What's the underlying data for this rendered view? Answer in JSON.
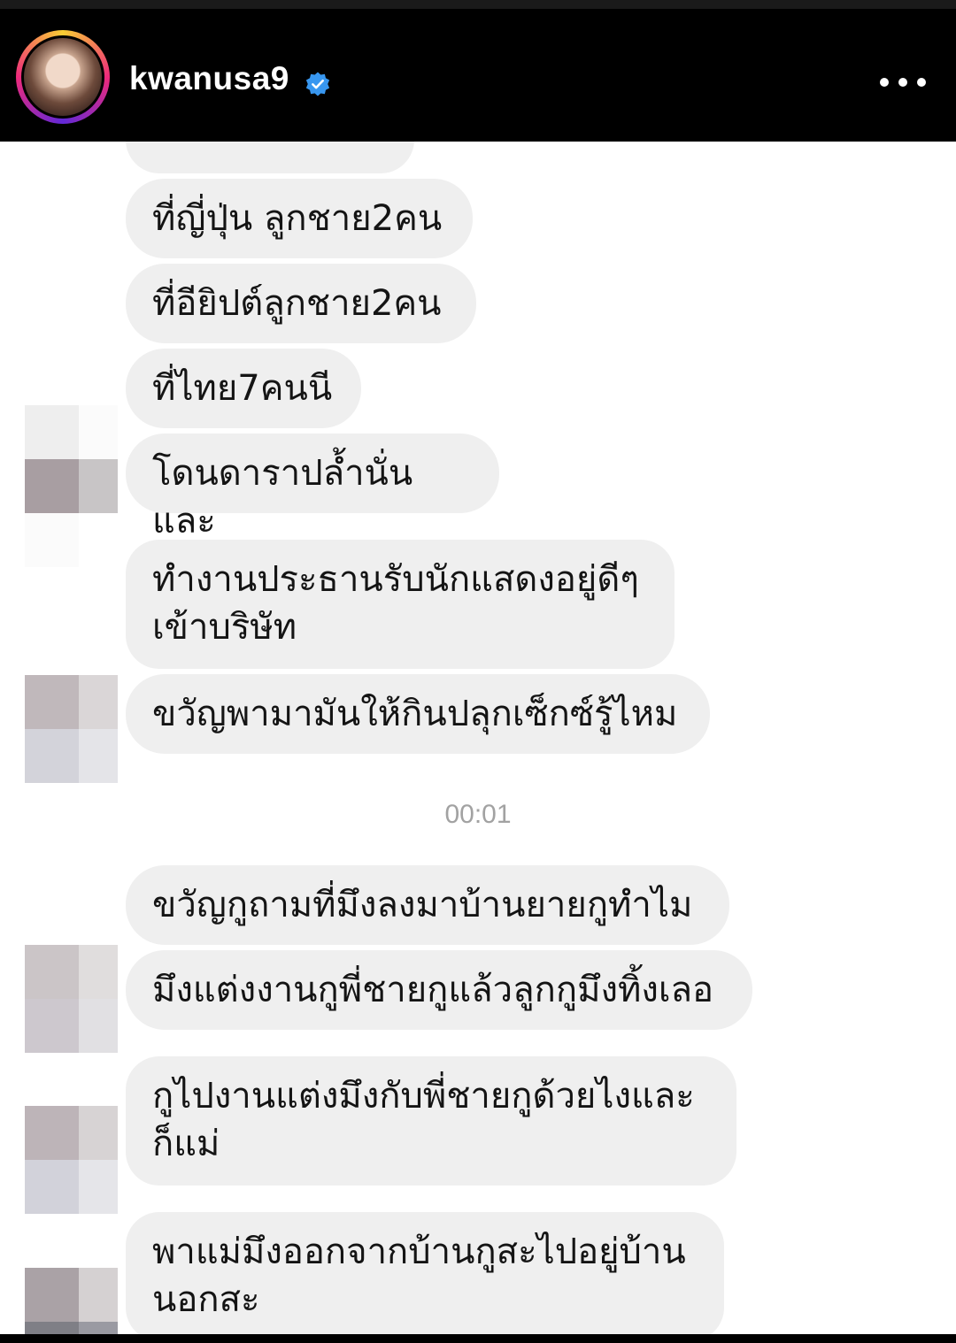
{
  "header": {
    "username": "kwanusa9",
    "verified": true,
    "more_icon": "more-horizontal-icon"
  },
  "chat": {
    "messages_before": [
      {
        "text": "ที่ญี่ปุ่น ลูกชาย2คน"
      },
      {
        "text": "ที่อียิปต์ลูกชาย2คน"
      },
      {
        "text": "ที่ไทย7คนนี"
      },
      {
        "text": "โดนดาราปล้ำนั่นและ"
      },
      {
        "text": "ทำงานประธานรับนักแสดงอยู่ดีๆ\nเข้าบริษัท"
      },
      {
        "text": "ขวัญพามามันให้กินปลุกเซ็กซ์รู้ไหม"
      }
    ],
    "timestamp": "00:01",
    "messages_after": [
      {
        "text": "ขวัญกูถามที่มึงลงมาบ้านยายกูทำไม"
      },
      {
        "text": "มึงแต่งงานกูพี่ชายกูแล้วลูกกูมึงทิ้งเลอ"
      },
      {
        "text": "กูไปงานแต่งมึงกับพี่ชายกูด้วยไงและ\nก็แม่"
      },
      {
        "text": "พาแม่มึงออกจากบ้านกูสะไปอยู่บ้าน\nนอกสะ"
      }
    ]
  },
  "colors": {
    "bubble": "#efefef",
    "text": "#141414",
    "timestamp": "#a2a2a2",
    "verified": "#3897f0"
  }
}
